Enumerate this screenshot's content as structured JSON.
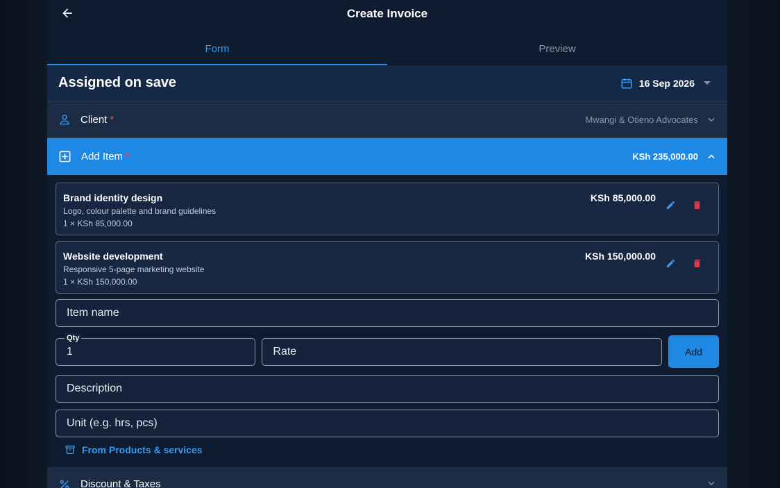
{
  "header": {
    "title": "Create Invoice"
  },
  "tabs": [
    {
      "label": "Form",
      "active": true
    },
    {
      "label": "Preview",
      "active": false
    }
  ],
  "invoice": {
    "number_text": "Assigned on save",
    "date": "16 Sep 2026"
  },
  "client": {
    "label": "Client",
    "required_mark": "*",
    "value": "Mwangi & Otieno Advocates"
  },
  "add_item": {
    "label": "Add Item",
    "required_mark": "*",
    "total": "KSh 235,000.00"
  },
  "items": [
    {
      "name": "Brand identity design",
      "description": "Logo, colour palette and brand guidelines",
      "qty_line": "1 × KSh 85,000.00",
      "amount": "KSh 85,000.00"
    },
    {
      "name": "Website development",
      "description": "Responsive 5-page marketing website",
      "qty_line": "1 × KSh 150,000.00",
      "amount": "KSh 150,000.00"
    }
  ],
  "form": {
    "item_name_placeholder": "Item name",
    "qty_label": "Qty",
    "qty_value": "1",
    "rate_placeholder": "Rate",
    "add_label": "Add",
    "description_placeholder": "Description",
    "unit_placeholder": "Unit (e.g. hrs, pcs)",
    "products_link": "From Products & services"
  },
  "discount": {
    "label": "Discount & Taxes"
  },
  "colors": {
    "accent": "#1e88e5",
    "required": "#ff3b3b",
    "delete": "#e53945",
    "background": "#0f1b2e"
  },
  "icons": {
    "back": "arrow-left-icon",
    "date": "calendar-icon",
    "client": "person-icon",
    "add_item": "plus-square-icon",
    "edit": "pencil-icon",
    "delete": "trash-icon",
    "products": "archive-icon",
    "discount": "percent-icon"
  }
}
